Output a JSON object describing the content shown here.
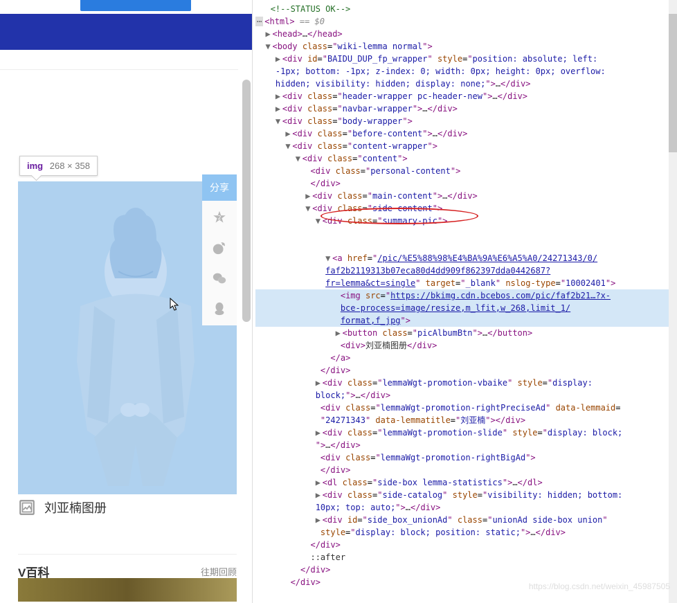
{
  "left": {
    "tooltip_tag": "img",
    "tooltip_dim": "268 × 358",
    "share_label": "分享",
    "album_text": "刘亚楠图册",
    "vwiki_title": "V百科",
    "vwiki_more": "往期回顾"
  },
  "code": {
    "comment_status": "<!--STATUS OK-->",
    "html_eq": "== $0",
    "head_open": "<head>",
    "head_dots": "…",
    "head_close": "</head>",
    "body_tag": "body",
    "body_class": "wiki-lemma normal",
    "fp_wrapper_id": "BAIDU_DUP_fp_wrapper",
    "fp_wrapper_style": "position: absolute; left: -1px; bottom: -1px; z-index: 0; width: 0px; height: 0px; overflow: hidden; visibility: hidden; display: none;",
    "header_wrapper_class": "header-wrapper pc-header-new",
    "navbar_wrapper_class": "navbar-wrapper",
    "body_wrapper_class": "body-wrapper",
    "before_content_class": "before-content",
    "content_wrapper_class": "content-wrapper",
    "content_class": "content",
    "personal_content_class": "personal-content",
    "main_content_class": "main-content",
    "side_content_class": "side-content",
    "summary_pic_class": "summary-pic",
    "a_href_line1": "/pic/%E5%88%98%E4%BA%9A%E6%A5%A0/24271343/0/",
    "a_href_line2": "faf2b2119313b07eca80d4dd909f862397dda0442687?",
    "a_href_line3": "fr=lemma&ct=single",
    "a_target": "_blank",
    "a_nslog": "10002401",
    "img_src_line1": "https://bkimg.cdn.bcebos.com/pic/faf2b21…?x-",
    "img_src_line2": "bce-process=image/resize,m_lfit,w_268,limit_1/",
    "img_src_line3": "format,f_jpg",
    "button_class": "picAlbumBtn",
    "div_album_text": "刘亚楠图册",
    "promo_vbaike_class": "lemmaWgt-promotion-vbaike",
    "promo_vbaike_style": "display: block;",
    "promo_precise_class": "lemmaWgt-promotion-rightPreciseAd",
    "promo_precise_lemmaid": "24271343",
    "promo_precise_title": "刘亚楠",
    "promo_slide_class": "lemmaWgt-promotion-slide",
    "promo_slide_style": "display: block;",
    "promo_bigad_class": "lemmaWgt-promotion-rightBigAd",
    "dl_class": "side-box lemma-statistics",
    "catalog_class": "side-catalog",
    "catalog_style": "visibility: hidden; bottom: 10px; top: auto;",
    "unionad_id": "side_box_unionAd",
    "unionad_class": "unionAd side-box union",
    "unionad_style": "display: block; position: static;",
    "after_pseudo": "::after",
    "watermark": "https://blog.csdn.net/weixin_45987505"
  }
}
